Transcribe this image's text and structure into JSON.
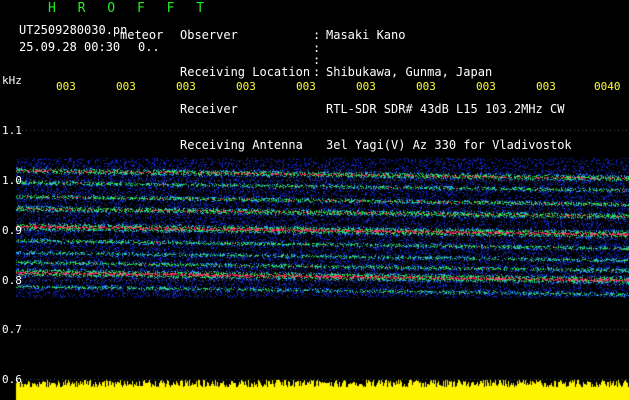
{
  "header": {
    "brand": "H R O F F T",
    "filename": "UT2509280030.pn",
    "meteor_label": "meteor",
    "datetime": "25.09.28 00:30",
    "meteor_count": "0..",
    "fields": [
      {
        "label": "Observer",
        "value": "Masaki Kano"
      },
      {
        "label": "Receiving Location",
        "value": "Shibukawa, Gunma, Japan"
      },
      {
        "label": "Receiver",
        "value": "RTL-SDR SDR# 43dB L15 103.2MHz CW"
      },
      {
        "label": "Receiving Antenna",
        "value": "3el Yagi(V) Az 330 for Vladivostok"
      }
    ]
  },
  "axis": {
    "unit": "kHz",
    "time_ticks": [
      "003",
      "003",
      "003",
      "003",
      "003",
      "003",
      "003",
      "003",
      "003",
      "0040"
    ],
    "freq_ticks": [
      "1.1",
      "1.0",
      "0.9",
      "0.8",
      "0.7",
      "0.6"
    ]
  },
  "colors": {
    "background": "#000000",
    "tick_text": "#ffff33",
    "brand": "#22ee22",
    "noise_floor": "#ffff00",
    "spectrum_low": "#1020c0",
    "spectrum_mid": "#20e060",
    "spectrum_high": "#ff2060"
  }
}
